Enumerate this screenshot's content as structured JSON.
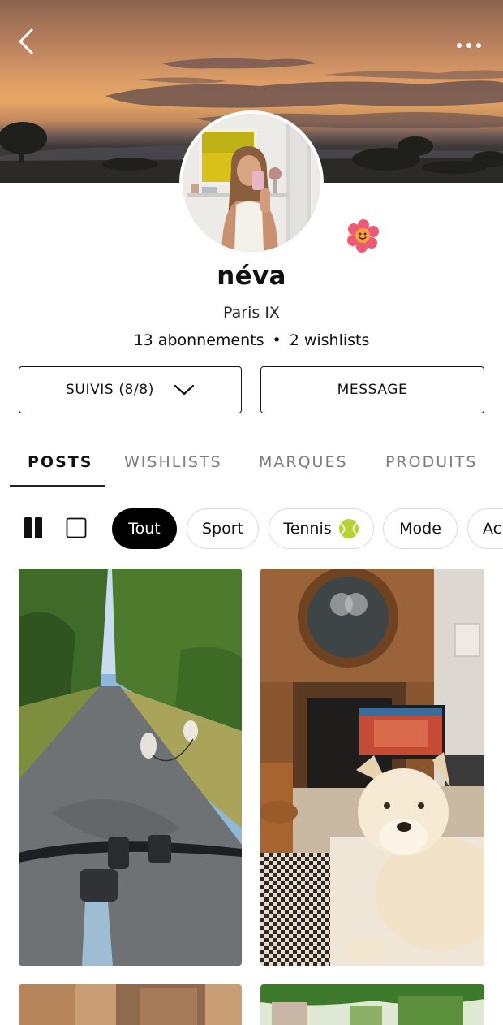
{
  "header": {
    "back_icon": "chevron-left-icon",
    "more_icon": "ellipsis-horizontal-icon"
  },
  "profile": {
    "name": "néva",
    "location": "Paris IX",
    "following_count": "13 abonnements",
    "separator": "•",
    "wishlists_count": "2 wishlists",
    "badge_icon": "smiling-flower-icon"
  },
  "actions": {
    "follow_label": "SUIVIS (8/8)",
    "follow_icon": "chevron-down-icon",
    "message_label": "MESSAGE"
  },
  "tabs": [
    {
      "label": "POSTS",
      "active": true
    },
    {
      "label": "WISHLISTS",
      "active": false
    },
    {
      "label": "MARQUES",
      "active": false
    },
    {
      "label": "PRODUITS",
      "active": false
    }
  ],
  "view_toggle": {
    "double_column_icon": "two-column-grid-icon",
    "single_column_icon": "single-square-icon",
    "active": "double"
  },
  "filters": [
    {
      "label": "Tout",
      "active": true
    },
    {
      "label": "Sport",
      "active": false
    },
    {
      "label": "Tennis",
      "active": false,
      "icon": "tennis-ball-icon"
    },
    {
      "label": "Mode",
      "active": false
    },
    {
      "label": "Ac",
      "active": false
    }
  ],
  "colors": {
    "accent": "#000000",
    "tennis_ball": "#b5d334",
    "border": "#d9d9d9"
  }
}
